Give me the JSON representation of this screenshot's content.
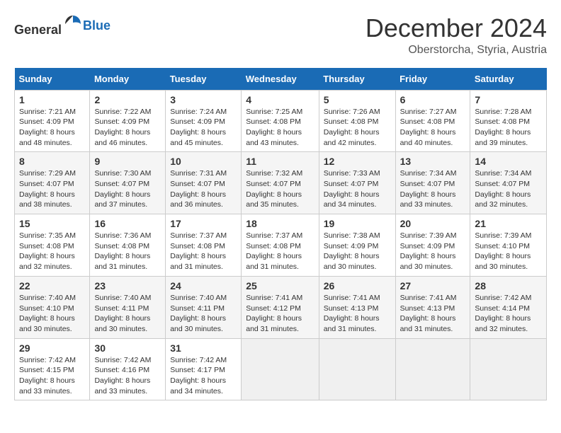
{
  "header": {
    "logo_general": "General",
    "logo_blue": "Blue",
    "month_title": "December 2024",
    "location": "Oberstorcha, Styria, Austria"
  },
  "weekdays": [
    "Sunday",
    "Monday",
    "Tuesday",
    "Wednesday",
    "Thursday",
    "Friday",
    "Saturday"
  ],
  "weeks": [
    [
      {
        "day": "1",
        "sunrise": "7:21 AM",
        "sunset": "4:09 PM",
        "daylight": "8 hours and 48 minutes."
      },
      {
        "day": "2",
        "sunrise": "7:22 AM",
        "sunset": "4:09 PM",
        "daylight": "8 hours and 46 minutes."
      },
      {
        "day": "3",
        "sunrise": "7:24 AM",
        "sunset": "4:09 PM",
        "daylight": "8 hours and 45 minutes."
      },
      {
        "day": "4",
        "sunrise": "7:25 AM",
        "sunset": "4:08 PM",
        "daylight": "8 hours and 43 minutes."
      },
      {
        "day": "5",
        "sunrise": "7:26 AM",
        "sunset": "4:08 PM",
        "daylight": "8 hours and 42 minutes."
      },
      {
        "day": "6",
        "sunrise": "7:27 AM",
        "sunset": "4:08 PM",
        "daylight": "8 hours and 40 minutes."
      },
      {
        "day": "7",
        "sunrise": "7:28 AM",
        "sunset": "4:08 PM",
        "daylight": "8 hours and 39 minutes."
      }
    ],
    [
      {
        "day": "8",
        "sunrise": "7:29 AM",
        "sunset": "4:07 PM",
        "daylight": "8 hours and 38 minutes."
      },
      {
        "day": "9",
        "sunrise": "7:30 AM",
        "sunset": "4:07 PM",
        "daylight": "8 hours and 37 minutes."
      },
      {
        "day": "10",
        "sunrise": "7:31 AM",
        "sunset": "4:07 PM",
        "daylight": "8 hours and 36 minutes."
      },
      {
        "day": "11",
        "sunrise": "7:32 AM",
        "sunset": "4:07 PM",
        "daylight": "8 hours and 35 minutes."
      },
      {
        "day": "12",
        "sunrise": "7:33 AM",
        "sunset": "4:07 PM",
        "daylight": "8 hours and 34 minutes."
      },
      {
        "day": "13",
        "sunrise": "7:34 AM",
        "sunset": "4:07 PM",
        "daylight": "8 hours and 33 minutes."
      },
      {
        "day": "14",
        "sunrise": "7:34 AM",
        "sunset": "4:07 PM",
        "daylight": "8 hours and 32 minutes."
      }
    ],
    [
      {
        "day": "15",
        "sunrise": "7:35 AM",
        "sunset": "4:08 PM",
        "daylight": "8 hours and 32 minutes."
      },
      {
        "day": "16",
        "sunrise": "7:36 AM",
        "sunset": "4:08 PM",
        "daylight": "8 hours and 31 minutes."
      },
      {
        "day": "17",
        "sunrise": "7:37 AM",
        "sunset": "4:08 PM",
        "daylight": "8 hours and 31 minutes."
      },
      {
        "day": "18",
        "sunrise": "7:37 AM",
        "sunset": "4:08 PM",
        "daylight": "8 hours and 31 minutes."
      },
      {
        "day": "19",
        "sunrise": "7:38 AM",
        "sunset": "4:09 PM",
        "daylight": "8 hours and 30 minutes."
      },
      {
        "day": "20",
        "sunrise": "7:39 AM",
        "sunset": "4:09 PM",
        "daylight": "8 hours and 30 minutes."
      },
      {
        "day": "21",
        "sunrise": "7:39 AM",
        "sunset": "4:10 PM",
        "daylight": "8 hours and 30 minutes."
      }
    ],
    [
      {
        "day": "22",
        "sunrise": "7:40 AM",
        "sunset": "4:10 PM",
        "daylight": "8 hours and 30 minutes."
      },
      {
        "day": "23",
        "sunrise": "7:40 AM",
        "sunset": "4:11 PM",
        "daylight": "8 hours and 30 minutes."
      },
      {
        "day": "24",
        "sunrise": "7:40 AM",
        "sunset": "4:11 PM",
        "daylight": "8 hours and 30 minutes."
      },
      {
        "day": "25",
        "sunrise": "7:41 AM",
        "sunset": "4:12 PM",
        "daylight": "8 hours and 31 minutes."
      },
      {
        "day": "26",
        "sunrise": "7:41 AM",
        "sunset": "4:13 PM",
        "daylight": "8 hours and 31 minutes."
      },
      {
        "day": "27",
        "sunrise": "7:41 AM",
        "sunset": "4:13 PM",
        "daylight": "8 hours and 31 minutes."
      },
      {
        "day": "28",
        "sunrise": "7:42 AM",
        "sunset": "4:14 PM",
        "daylight": "8 hours and 32 minutes."
      }
    ],
    [
      {
        "day": "29",
        "sunrise": "7:42 AM",
        "sunset": "4:15 PM",
        "daylight": "8 hours and 33 minutes."
      },
      {
        "day": "30",
        "sunrise": "7:42 AM",
        "sunset": "4:16 PM",
        "daylight": "8 hours and 33 minutes."
      },
      {
        "day": "31",
        "sunrise": "7:42 AM",
        "sunset": "4:17 PM",
        "daylight": "8 hours and 34 minutes."
      },
      null,
      null,
      null,
      null
    ]
  ],
  "labels": {
    "sunrise": "Sunrise:",
    "sunset": "Sunset:",
    "daylight": "Daylight:"
  }
}
